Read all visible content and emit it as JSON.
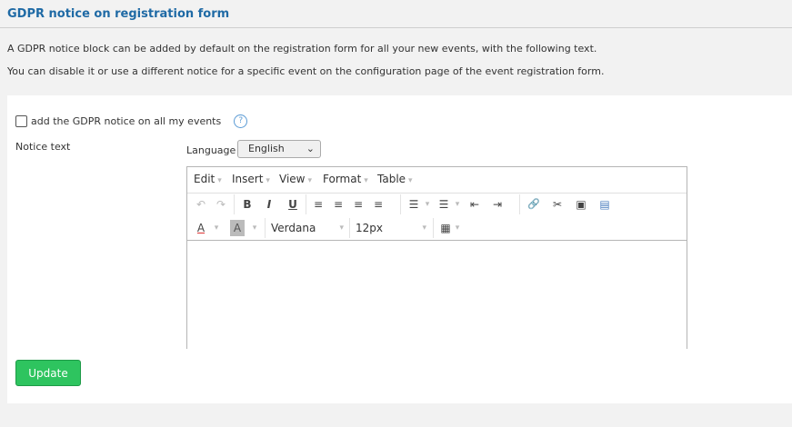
{
  "section": {
    "title": "GDPR notice on registration form",
    "intro_line1": "A GDPR notice block can be added by default on the registration form for all your new events, with the following text.",
    "intro_line2": "You can disable it or use a different notice for a specific event on the configuration page of the event registration form."
  },
  "form": {
    "checkbox_label": "add the GDPR notice on all my events",
    "checkbox_checked": false,
    "help_icon": "?",
    "notice_label": "Notice text",
    "language_label": "Language",
    "language_value": "English",
    "update_label": "Update"
  },
  "editor": {
    "menus": [
      "Edit",
      "Insert",
      "View",
      "Format",
      "Table"
    ],
    "toolbar": {
      "undo": "↶",
      "redo": "↷",
      "bold": "B",
      "italic": "I",
      "underline": "U",
      "align_left": "≡",
      "align_center": "≡",
      "align_right": "≡",
      "justify": "≡",
      "bullets": "☰",
      "numbers": "☰",
      "outdent": "⇤",
      "indent": "⇥",
      "link": "🔗",
      "unlink": "✂",
      "image": "▣",
      "media": "▤",
      "text_color": "A",
      "bg_color": "A",
      "table": "▦"
    },
    "font_family": "Verdana",
    "font_size": "12px",
    "content": ""
  },
  "colors": {
    "title": "#1f6aa5",
    "button": "#2ec45f",
    "help": "#5b9bd5"
  }
}
